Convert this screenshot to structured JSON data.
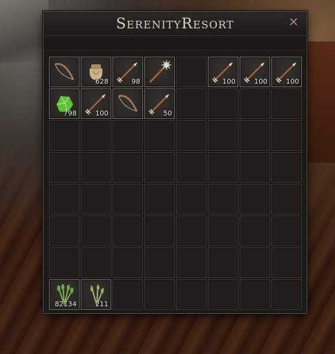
{
  "window": {
    "title": "SerenityResort",
    "close_glyph": "✕"
  },
  "grid": {
    "columns": 8,
    "rows": 8
  },
  "slots": [
    {
      "index": 0,
      "icon": "bow-icon",
      "qty": ""
    },
    {
      "index": 1,
      "icon": "sack-icon",
      "qty": "628"
    },
    {
      "index": 2,
      "icon": "arrow-icon",
      "qty": "98"
    },
    {
      "index": 3,
      "icon": "spiked-arrow-icon",
      "qty": ""
    },
    {
      "index": 5,
      "icon": "arrow-icon",
      "qty": "100"
    },
    {
      "index": 6,
      "icon": "arrow-icon",
      "qty": "100"
    },
    {
      "index": 7,
      "icon": "arrow-icon",
      "qty": "100"
    },
    {
      "index": 8,
      "icon": "green-ore-icon",
      "qty": "798"
    },
    {
      "index": 9,
      "icon": "arrow-icon",
      "qty": "100"
    },
    {
      "index": 10,
      "icon": "bow-icon",
      "qty": ""
    },
    {
      "index": 11,
      "icon": "arrow-icon",
      "qty": "50"
    },
    {
      "index": 56,
      "icon": "herb-bundle-icon",
      "qty": "82134"
    },
    {
      "index": 57,
      "icon": "herb-sprig-icon",
      "qty": "211"
    }
  ]
}
